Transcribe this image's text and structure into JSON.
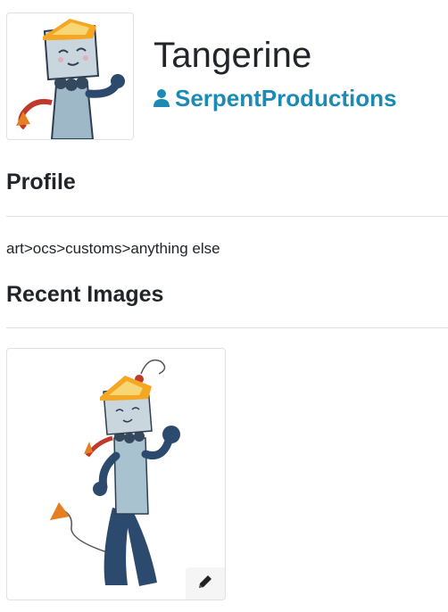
{
  "header": {
    "character_name": "Tangerine",
    "owner_name": "SerpentProductions"
  },
  "profile": {
    "heading": "Profile",
    "text": "art>ocs>customs>anything else"
  },
  "recent_images": {
    "heading": "Recent Images"
  },
  "icons": {
    "user": "user-icon",
    "edit": "pencil-icon"
  },
  "colors": {
    "link": "#1b8bb5",
    "text": "#212529",
    "border": "#dee2e6"
  }
}
